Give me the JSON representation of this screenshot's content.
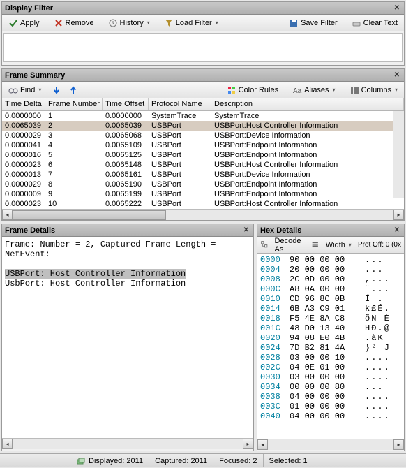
{
  "panes": {
    "filter": {
      "title": "Display Filter"
    },
    "summary": {
      "title": "Frame Summary"
    },
    "details": {
      "title": "Frame Details"
    },
    "hex": {
      "title": "Hex Details"
    }
  },
  "filter_toolbar": {
    "apply": "Apply",
    "remove": "Remove",
    "history": "History",
    "load_filter": "Load Filter",
    "save_filter": "Save Filter",
    "clear_text": "Clear Text"
  },
  "summary_toolbar": {
    "find": "Find",
    "color_rules": "Color Rules",
    "aliases": "Aliases",
    "columns": "Columns"
  },
  "summary_columns": [
    "Time Delta",
    "Frame Number",
    "Time Offset",
    "Protocol Name",
    "Description"
  ],
  "summary_rows": [
    {
      "td": "0.0000000",
      "fn": "1",
      "to": "0.0000000",
      "pn": "SystemTrace",
      "desc": "SystemTrace",
      "sel": false
    },
    {
      "td": "0.0065039",
      "fn": "2",
      "to": "0.0065039",
      "pn": "USBPort",
      "desc": "USBPort:Host Controller Information",
      "sel": true
    },
    {
      "td": "0.0000029",
      "fn": "3",
      "to": "0.0065068",
      "pn": "USBPort",
      "desc": "USBPort:Device Information",
      "sel": false
    },
    {
      "td": "0.0000041",
      "fn": "4",
      "to": "0.0065109",
      "pn": "USBPort",
      "desc": "USBPort:Endpoint Information",
      "sel": false
    },
    {
      "td": "0.0000016",
      "fn": "5",
      "to": "0.0065125",
      "pn": "USBPort",
      "desc": "USBPort:Endpoint Information",
      "sel": false
    },
    {
      "td": "0.0000023",
      "fn": "6",
      "to": "0.0065148",
      "pn": "USBPort",
      "desc": "USBPort:Host Controller Information",
      "sel": false
    },
    {
      "td": "0.0000013",
      "fn": "7",
      "to": "0.0065161",
      "pn": "USBPort",
      "desc": "USBPort:Device Information",
      "sel": false
    },
    {
      "td": "0.0000029",
      "fn": "8",
      "to": "0.0065190",
      "pn": "USBPort",
      "desc": "USBPort:Endpoint Information",
      "sel": false
    },
    {
      "td": "0.0000009",
      "fn": "9",
      "to": "0.0065199",
      "pn": "USBPort",
      "desc": "USBPort:Endpoint Information",
      "sel": false
    },
    {
      "td": "0.0000023",
      "fn": "10",
      "to": "0.0065222",
      "pn": "USBPort",
      "desc": "USBPort:Host Controller Information",
      "sel": false
    }
  ],
  "details_lines": {
    "l1": "Frame: Number = 2, Captured Frame Length =",
    "l2": "NetEvent:",
    "l3": "USBPort: Host Controller Information",
    "l4": "UsbPort: Host Controller Information"
  },
  "hex_toolbar": {
    "decode_as": "Decode As",
    "width": "Width",
    "prot_off": "Prot Off: 0 (0x"
  },
  "hex_rows": [
    {
      "addr": "0000",
      "b": "90 00 00 00",
      "a": "..."
    },
    {
      "addr": "0004",
      "b": "20 00 00 00",
      "a": "..."
    },
    {
      "addr": "0008",
      "b": "2C 0D 00 00",
      "a": ",..."
    },
    {
      "addr": "000C",
      "b": "A8 0A 00 00",
      "a": "¨..."
    },
    {
      "addr": "0010",
      "b": "CD 96 8C 0B",
      "a": "Í   ."
    },
    {
      "addr": "0014",
      "b": "6B A3 C9 01",
      "a": "k£É."
    },
    {
      "addr": "0018",
      "b": "F5 4E 8A C8",
      "a": "õN  È"
    },
    {
      "addr": "001C",
      "b": "48 D0 13 40",
      "a": "HÐ.@"
    },
    {
      "addr": "0020",
      "b": "94 08 E0 4B",
      "a": " .àK"
    },
    {
      "addr": "0024",
      "b": "7D B2 81 4A",
      "a": "}²  J"
    },
    {
      "addr": "0028",
      "b": "03 00 00 10",
      "a": "...."
    },
    {
      "addr": "002C",
      "b": "04 0E 01 00",
      "a": "...."
    },
    {
      "addr": "0030",
      "b": "03 00 00 00",
      "a": "...."
    },
    {
      "addr": "0034",
      "b": "00 00 00 80",
      "a": "..."
    },
    {
      "addr": "0038",
      "b": "04 00 00 00",
      "a": "...."
    },
    {
      "addr": "003C",
      "b": "01 00 00 00",
      "a": "...."
    },
    {
      "addr": "0040",
      "b": "04 00 00 00",
      "a": "...."
    }
  ],
  "status": {
    "displayed": "Displayed: 2011",
    "captured": "Captured: 2011",
    "focused": "Focused: 2",
    "selected": "Selected: 1"
  }
}
